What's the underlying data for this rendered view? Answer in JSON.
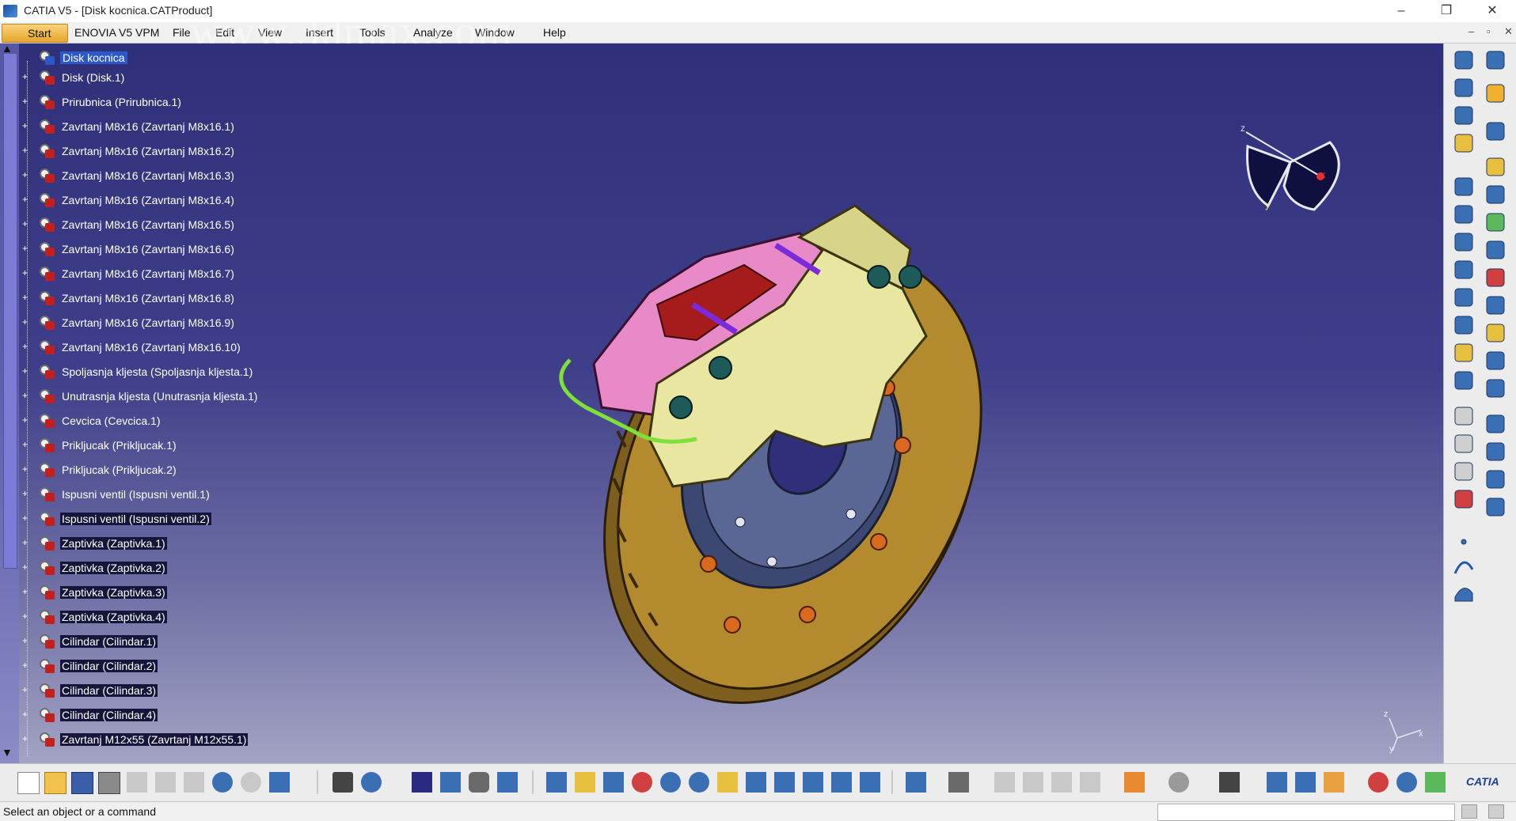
{
  "window": {
    "title": "CATIA V5 - [Disk kocnica.CATProduct]",
    "minimize": "–",
    "restore": "❐",
    "close": "✕"
  },
  "watermark": "www.3dmax.com",
  "menu": {
    "start": "Start",
    "items": [
      "ENOVIA V5 VPM",
      "File",
      "Edit",
      "View",
      "Insert",
      "Tools",
      "Analyze",
      "Window",
      "Help"
    ],
    "mdi": [
      "–",
      "▫",
      "✕"
    ]
  },
  "tree": {
    "root": "Disk kocnica",
    "items": [
      "Disk (Disk.1)",
      "Prirubnica (Prirubnica.1)",
      "Zavrtanj M8x16 (Zavrtanj M8x16.1)",
      "Zavrtanj M8x16 (Zavrtanj M8x16.2)",
      "Zavrtanj M8x16 (Zavrtanj M8x16.3)",
      "Zavrtanj M8x16 (Zavrtanj M8x16.4)",
      "Zavrtanj M8x16 (Zavrtanj M8x16.5)",
      "Zavrtanj M8x16 (Zavrtanj M8x16.6)",
      "Zavrtanj M8x16 (Zavrtanj M8x16.7)",
      "Zavrtanj M8x16 (Zavrtanj M8x16.8)",
      "Zavrtanj M8x16 (Zavrtanj M8x16.9)",
      "Zavrtanj M8x16 (Zavrtanj M8x16.10)",
      "Spoljasnja kljesta (Spoljasnja kljesta.1)",
      "Unutrasnja kljesta (Unutrasnja kljesta.1)",
      "Cevcica (Cevcica.1)",
      "Prikljucak (Prikljucak.1)",
      "Prikljucak (Prikljucak.2)",
      "Ispusni ventil (Ispusni ventil.1)",
      "Ispusni ventil (Ispusni ventil.2)",
      "Zaptivka (Zaptivka.1)",
      "Zaptivka (Zaptivka.2)",
      "Zaptivka (Zaptivka.3)",
      "Zaptivka (Zaptivka.4)",
      "Cilindar (Cilindar.1)",
      "Cilindar (Cilindar.2)",
      "Cilindar (Cilindar.3)",
      "Cilindar (Cilindar.4)",
      "Zavrtanj M12x55 (Zavrtanj M12x55.1)"
    ]
  },
  "compass": {
    "x": "x",
    "y": "y",
    "z": "z"
  },
  "axis": {
    "x": "x",
    "y": "y",
    "z": "z"
  },
  "status": {
    "text": "Select an object or a command",
    "power_input": ""
  },
  "brand": "CATIA",
  "colors": {
    "viewport_top": "#30307a",
    "viewport_bottom": "#a3a3c4",
    "disc": "#b38a2e",
    "caliper_yellow": "#e8e6a0",
    "caliper_pink": "#e98ac8",
    "hub": "#4d5a86",
    "bolts": "#d9691f",
    "selection": "#2b59c8"
  }
}
